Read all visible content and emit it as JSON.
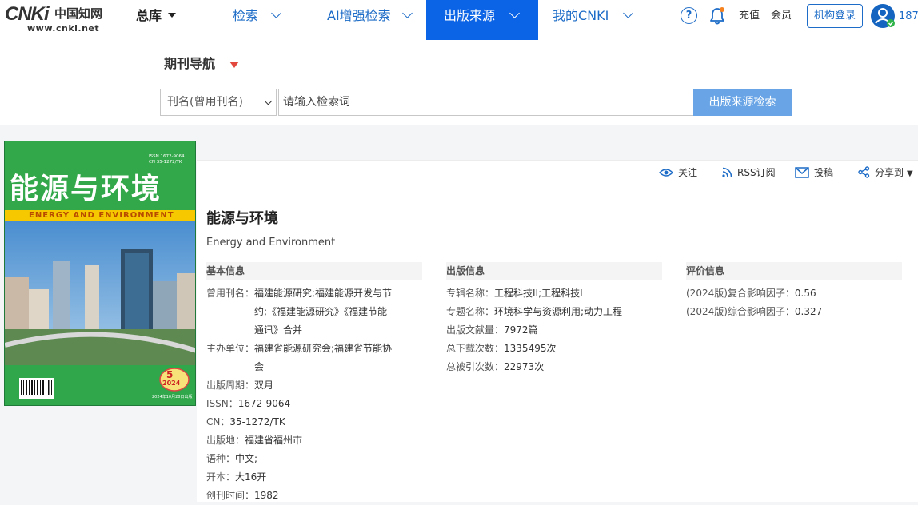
{
  "nav": {
    "logo_text": "CNKi",
    "logo_cn": "中国知网",
    "logo_url": "www.cnki.net",
    "zongku_label": "总库",
    "items": [
      {
        "label": "检索"
      },
      {
        "label": "AI增强检索"
      },
      {
        "label": "出版来源",
        "active": true
      },
      {
        "label": "我的CNKI"
      }
    ],
    "help_label": "?",
    "recharge_label": "充值",
    "member_label": "会员",
    "institution_login_label": "机构登录",
    "user_id_partial": "187",
    "accent_color": "#0b63e5"
  },
  "search": {
    "nav_title": "期刊导航",
    "field_select": "刊名(曾用刊名)",
    "placeholder": "请输入检索词",
    "button_label": "出版来源检索"
  },
  "actions": {
    "follow": "关注",
    "rss": "RSS订阅",
    "submit": "投稿",
    "share": "分享到"
  },
  "cover": {
    "title_cn": "能源与环境",
    "title_en": "ENERGY AND ENVIRONMENT",
    "issn_line": "ISSN 1672-9064",
    "cn_line": "CN 35-1272/TK",
    "issue": "5",
    "year": "2024",
    "publish_date": "2024年10月28日出版"
  },
  "journal": {
    "title": "能源与环境",
    "title_en": "Energy and Environment"
  },
  "basic_info": {
    "header": "基本信息",
    "former_names_label": "曾用刊名：",
    "former_names_lines": [
      "福建能源研究;福建能源开发与节",
      "约;《福建能源研究》《福建节能",
      "通讯》合并"
    ],
    "sponsor_label": "主办单位：",
    "sponsor_lines": [
      "福建省能源研究会;福建省节能协",
      "会"
    ],
    "cycle_label": "出版周期：",
    "cycle": "双月",
    "issn_label": "ISSN：",
    "issn": "1672-9064",
    "cn_label": "CN：",
    "cn": "35-1272/TK",
    "place_label": "出版地：",
    "place": "福建省福州市",
    "language_label": "语种：",
    "language": "中文;",
    "format_label": "开本：",
    "format": "大16开",
    "founded_label": "创刊时间：",
    "founded": "1982"
  },
  "publication_info": {
    "header": "出版信息",
    "album_label": "专辑名称：",
    "album": "工程科技II;工程科技I",
    "topic_label": "专题名称：",
    "topic": "环境科学与资源利用;动力工程",
    "docs_label": "出版文献量：",
    "docs": "7972篇",
    "downloads_label": "总下载次数：",
    "downloads": "1335495次",
    "citations_label": "总被引次数：",
    "citations": "22973次"
  },
  "evaluation_info": {
    "header": "评价信息",
    "composite_label": "(2024版)复合影响因子：",
    "composite": "0.56",
    "comprehensive_label": "(2024版)综合影响因子：",
    "comprehensive": "0.327"
  }
}
